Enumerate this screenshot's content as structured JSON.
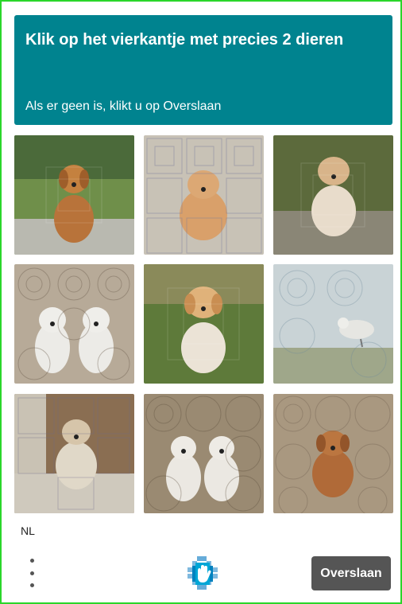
{
  "challenge": {
    "title": "Klik op het vierkantje met precies 2 dieren",
    "subtitle": "Als er geen is, klikt u op Overslaan",
    "header_color": "#00838f"
  },
  "tiles": [
    {
      "name": "tile-1",
      "content": "single-dog",
      "scene": "grass-path"
    },
    {
      "name": "tile-2",
      "content": "single-dog",
      "scene": "square-noise"
    },
    {
      "name": "tile-3",
      "content": "single-dog",
      "scene": "park-bench"
    },
    {
      "name": "tile-4",
      "content": "two-dogs",
      "scene": "circle-noise"
    },
    {
      "name": "tile-5",
      "content": "single-dog",
      "scene": "grass"
    },
    {
      "name": "tile-6",
      "content": "bird",
      "scene": "water"
    },
    {
      "name": "tile-7",
      "content": "single-dog",
      "scene": "couch"
    },
    {
      "name": "tile-8",
      "content": "two-dogs",
      "scene": "circle-noise"
    },
    {
      "name": "tile-9",
      "content": "single-dog",
      "scene": "circle-noise"
    }
  ],
  "footer": {
    "language": "NL",
    "skip_label": "Overslaan",
    "menu_icon": "vertical-dots-icon",
    "logo_icon": "hcaptcha-hand-logo"
  }
}
